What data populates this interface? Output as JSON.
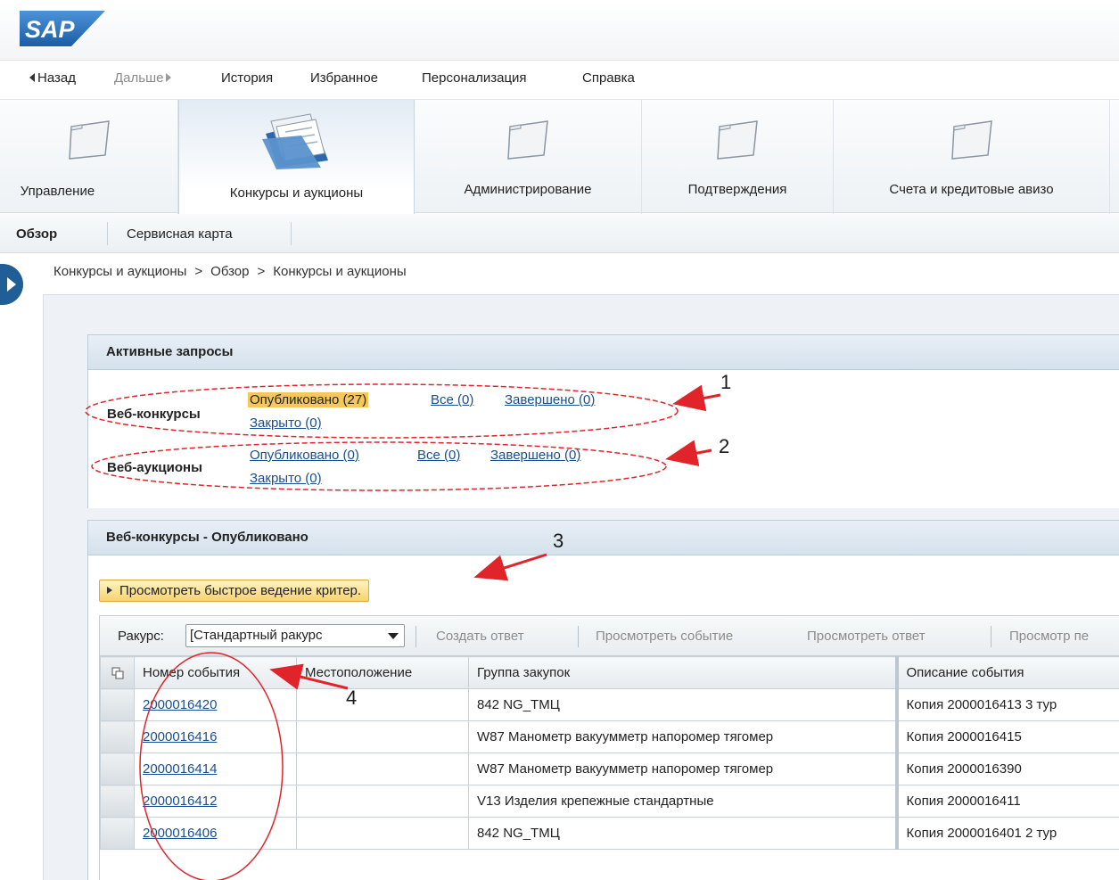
{
  "header": {
    "logo_text": "SAP",
    "colors": {
      "brand_blue": "#1a5da6",
      "panel_bg": "#eef2f6",
      "active_link_bg": "#f6c75a",
      "annotation_red": "#e0242a"
    }
  },
  "nav": {
    "back": "Назад",
    "forward": "Дальше",
    "history": "История",
    "favorites": "Избранное",
    "personalization": "Персонализация",
    "help": "Справка"
  },
  "tabs": [
    {
      "label": "Управление",
      "icon": "folder-icon",
      "active": false
    },
    {
      "label": "Конкурсы и аукционы",
      "icon": "documents-folder-icon",
      "active": true
    },
    {
      "label": "Администрирование",
      "icon": "folder-icon",
      "active": false
    },
    {
      "label": "Подтверждения",
      "icon": "folder-icon",
      "active": false
    },
    {
      "label": "Счета и кредитовые авизо",
      "icon": "folder-icon",
      "active": false
    }
  ],
  "subtabs": [
    {
      "label": "Обзор",
      "active": true
    },
    {
      "label": "Сервисная карта",
      "active": false
    }
  ],
  "breadcrumb": {
    "items": [
      "Конкурсы и аукционы",
      "Обзор",
      "Конкурсы и аукционы"
    ],
    "separator": ">"
  },
  "active_requests": {
    "title": "Активные запросы",
    "web_tenders": {
      "label": "Веб-конкурсы",
      "published": "Опубликовано (27)",
      "all": "Все (0)",
      "completed": "Завершено (0)",
      "closed": "Закрыто (0)"
    },
    "web_auctions": {
      "label": "Веб-аукционы",
      "published": "Опубликовано (0)",
      "all": "Все (0)",
      "completed": "Завершено (0)",
      "closed": "Закрыто (0)"
    }
  },
  "published_section": {
    "title": "Веб-конкурсы - Опубликовано",
    "quick_criteria_button": "Просмотреть быстрое ведение критер.",
    "toolbar": {
      "view_label": "Ракурс:",
      "view_value": "[Стандартный ракурс",
      "create_response": "Создать ответ",
      "view_event": "Просмотреть событие",
      "view_response": "Просмотреть ответ",
      "view_more": "Просмотр пе"
    },
    "columns": [
      "Номер события",
      "Местоположение",
      "Группа закупок",
      "Описание события"
    ],
    "rows": [
      {
        "event_number": "2000016420",
        "location": "",
        "purchasing_group": "842 NG_ТМЦ",
        "description": "Копия 2000016413 3 тур"
      },
      {
        "event_number": "2000016416",
        "location": "",
        "purchasing_group": "W87 Манометр вакуумметр напоромер тягомер",
        "description": "Копия 2000016415"
      },
      {
        "event_number": "2000016414",
        "location": "",
        "purchasing_group": "W87 Манометр вакуумметр напоромер тягомер",
        "description": "Копия 2000016390"
      },
      {
        "event_number": "2000016412",
        "location": "",
        "purchasing_group": "V13 Изделия крепежные стандартные",
        "description": "Копия 2000016411"
      },
      {
        "event_number": "2000016406",
        "location": "",
        "purchasing_group": "842 NG_ТМЦ",
        "description": "Копия 2000016401 2 тур"
      }
    ]
  },
  "annotations": [
    "1",
    "2",
    "3",
    "4"
  ]
}
